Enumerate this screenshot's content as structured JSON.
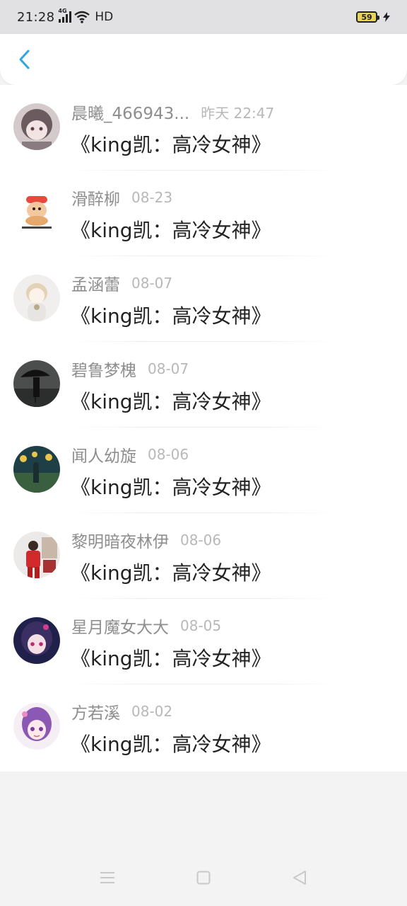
{
  "status_bar": {
    "time": "21:28",
    "network": "4G",
    "hd": "HD",
    "battery": "59"
  },
  "header": {
    "back_icon": "chevron-left-icon",
    "accent_color": "#2ea7e0"
  },
  "messages": [
    {
      "name": "晨曦_466943...",
      "time": "昨天 22:47",
      "text": "《king凯：高冷女神》"
    },
    {
      "name": "滑醉柳",
      "time": "08-23",
      "text": "《king凯：高冷女神》"
    },
    {
      "name": "孟涵蕾",
      "time": "08-07",
      "text": "《king凯：高冷女神》"
    },
    {
      "name": "碧鲁梦槐",
      "time": "08-07",
      "text": "《king凯：高冷女神》"
    },
    {
      "name": "闻人幼旋",
      "time": "08-06",
      "text": "《king凯：高冷女神》"
    },
    {
      "name": "黎明暗夜林伊",
      "time": "08-06",
      "text": "《king凯：高冷女神》"
    },
    {
      "name": "星月魔女大大",
      "time": "08-05",
      "text": "《king凯：高冷女神》"
    },
    {
      "name": "方若溪",
      "time": "08-02",
      "text": "《king凯：高冷女神》"
    }
  ],
  "nav": {
    "menu_icon": "menu-icon",
    "home_icon": "square-home-icon",
    "back_icon": "triangle-back-icon"
  }
}
